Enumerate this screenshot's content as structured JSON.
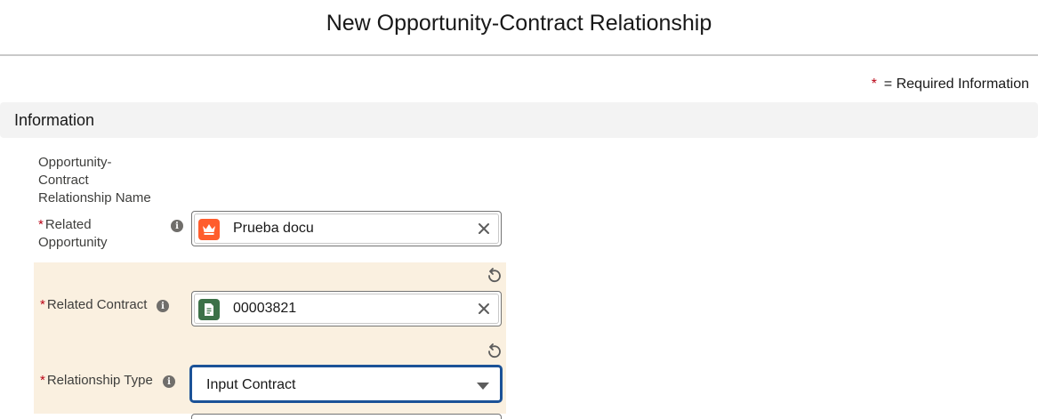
{
  "modal": {
    "title": "New Opportunity-Contract Relationship"
  },
  "required_legend": {
    "star": "*",
    "text": "= Required Information"
  },
  "section": {
    "title": "Information"
  },
  "fields": {
    "name": {
      "label_line1": "Opportunity-",
      "label_line2": "Contract",
      "label_line3": "Relationship Name"
    },
    "related_opportunity": {
      "required": "*",
      "label_line1": "Related",
      "label_line2": "Opportunity",
      "value": "Prueba docu",
      "icon": "opportunity-crown-icon",
      "icon_color": "#ff5d2d"
    },
    "related_contract": {
      "required": "*",
      "label": "Related Contract",
      "value": "00003821",
      "icon": "contract-document-icon",
      "icon_color": "#3c7148"
    },
    "relationship_type": {
      "required": "*",
      "label": "Relationship Type",
      "value": "Input Contract"
    }
  },
  "icons": {
    "info": "info-icon",
    "clear": "close-icon",
    "undo": "undo-icon",
    "dropdown": "chevron-down-icon"
  },
  "colors": {
    "required_star": "#ba0517",
    "edited_background": "#faf0e0",
    "focus_border": "#1b5297",
    "section_background": "#f3f3f3"
  }
}
